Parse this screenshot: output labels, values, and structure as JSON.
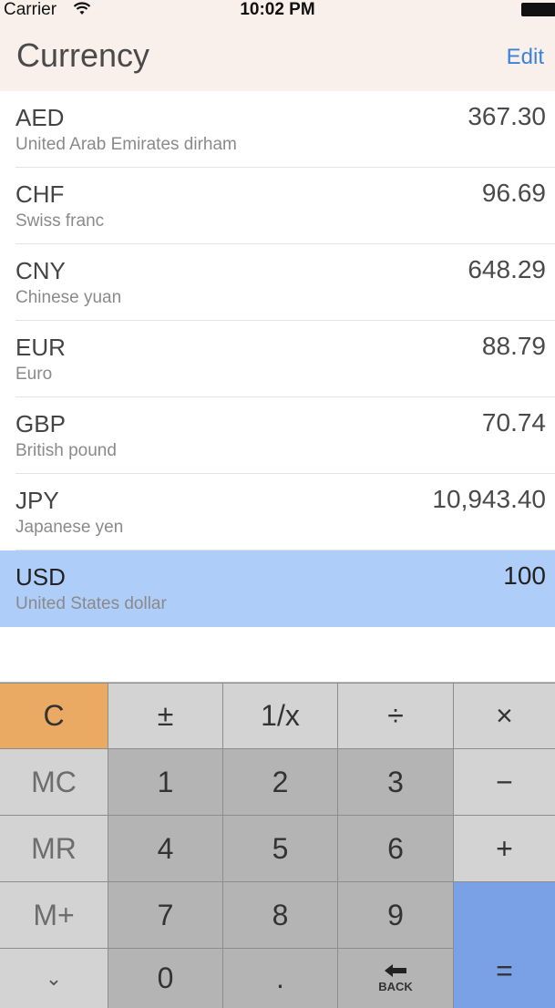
{
  "status_bar": {
    "carrier": "Carrier",
    "time": "10:02 PM"
  },
  "nav": {
    "title": "Currency",
    "edit_label": "Edit"
  },
  "currencies": [
    {
      "code": "AED",
      "name": "United Arab Emirates dirham",
      "amount": "367.30"
    },
    {
      "code": "CHF",
      "name": "Swiss franc",
      "amount": "96.69"
    },
    {
      "code": "CNY",
      "name": "Chinese yuan",
      "amount": "648.29"
    },
    {
      "code": "EUR",
      "name": "Euro",
      "amount": "88.79"
    },
    {
      "code": "GBP",
      "name": "British pound",
      "amount": "70.74"
    },
    {
      "code": "JPY",
      "name": "Japanese yen",
      "amount": "10,943.40"
    },
    {
      "code": "USD",
      "name": "United States dollar",
      "amount": "100",
      "selected": true
    }
  ],
  "keypad": {
    "clear": "C",
    "plus_minus": "±",
    "reciprocal": "1/x",
    "divide": "÷",
    "multiply": "×",
    "mc": "MC",
    "mr": "MR",
    "m_plus": "M+",
    "collapse": "⌄",
    "minus": "−",
    "plus": "+",
    "equals": "=",
    "digits": [
      "0",
      "1",
      "2",
      "3",
      "4",
      "5",
      "6",
      "7",
      "8",
      "9"
    ],
    "decimal": ".",
    "back": "BACK"
  },
  "colors": {
    "nav_background": "#f9efeb",
    "edit_accent": "#3b83d6",
    "selected_row": "#aecdf9",
    "clear_key": "#ebaa63",
    "equals_key": "#7aa0e6"
  },
  "icons": {
    "wifi": "wifi-icon",
    "battery": "battery-icon",
    "back": "back-arrow-icon",
    "collapse": "chevron-down-icon"
  }
}
